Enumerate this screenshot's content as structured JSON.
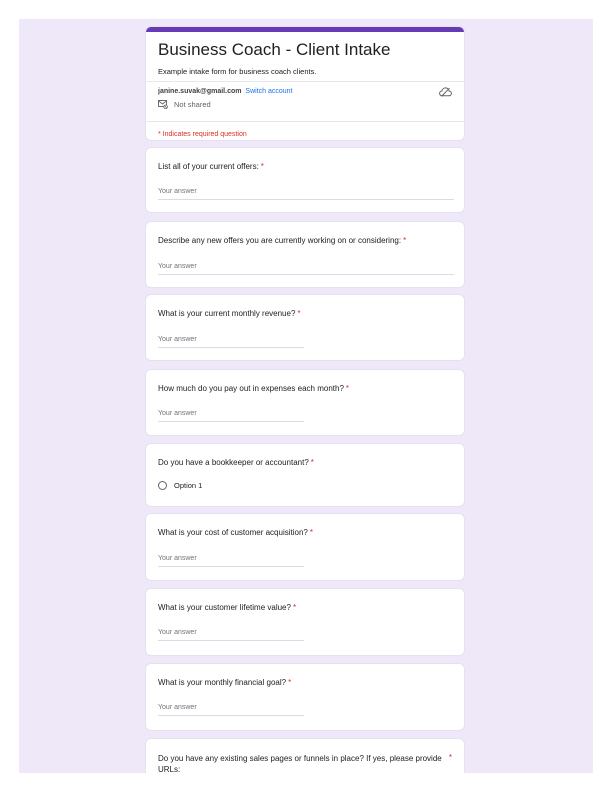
{
  "form": {
    "title": "Business Coach - Client Intake",
    "description": "Example intake form for business coach clients.",
    "account_email": "janine.suvak@gmail.com",
    "switch_account": "Switch account",
    "shared_status": "Not shared",
    "required_note": "* Indicates required question",
    "accent_color": "#673ab7",
    "required_color": "#d93025",
    "link_color": "#1a73e8"
  },
  "questions": [
    {
      "title": "List all of your current offers:",
      "required_mark": "*",
      "answer_placeholder": "Your answer"
    },
    {
      "title": "Describe any new offers you are currently working on or considering:",
      "required_mark": "*",
      "answer_placeholder": "Your answer"
    },
    {
      "title": "What is your current monthly revenue?",
      "required_mark": "*",
      "answer_placeholder": "Your answer"
    },
    {
      "title": "How much do you pay out in expenses each month?",
      "required_mark": "*",
      "answer_placeholder": "Your answer"
    },
    {
      "title": "Do you have a bookkeeper or accountant?",
      "required_mark": "*",
      "option": "Option 1"
    },
    {
      "title": "What is your cost of customer acquisition?",
      "required_mark": "*",
      "answer_placeholder": "Your answer"
    },
    {
      "title": "What is your customer lifetime value?",
      "required_mark": "*",
      "answer_placeholder": "Your answer"
    },
    {
      "title": "What is your monthly financial goal?",
      "required_mark": "*",
      "answer_placeholder": "Your answer"
    },
    {
      "title": "Do you have any existing sales pages or funnels in place? If yes, please provide URLs:",
      "required_mark": "*"
    }
  ]
}
